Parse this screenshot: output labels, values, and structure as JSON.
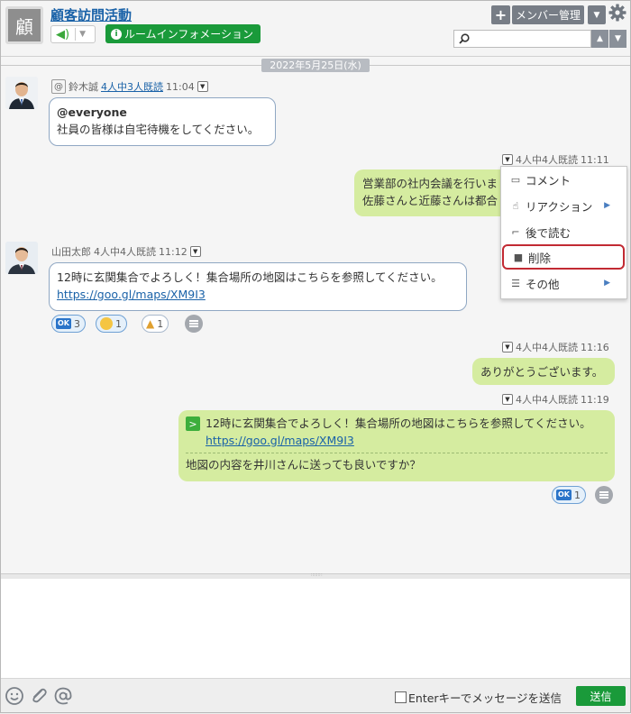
{
  "header": {
    "room_icon_char": "顧",
    "room_title": "顧客訪問活動",
    "room_info_label": "ルームインフォメーション",
    "member_button_label": "メンバー管理",
    "search_placeholder": ""
  },
  "date_separator": "2022年5月25日(水)",
  "messages": [
    {
      "sender": "鈴木誠",
      "read_status": "4人中3人既読",
      "time": "11:04",
      "lines": [
        "@everyone",
        "社員の皆様は自宅待機をしてください。"
      ]
    },
    {
      "self": true,
      "read_status": "4人中4人既読",
      "time": "11:11",
      "lines": [
        "営業部の社内会議を行いま",
        "佐藤さんと近藤さんは都合"
      ]
    },
    {
      "sender": "山田太郎",
      "read_status": "4人中4人既読",
      "time": "11:12",
      "lines": [
        "12時に玄関集合でよろしく！集合場所の地図はこちらを参照してください。"
      ],
      "link": "https://goo.gl/maps/XM9I3",
      "reactions": [
        {
          "icon": "ok-icon",
          "count": "3"
        },
        {
          "icon": "smile-icon",
          "count": "1"
        },
        {
          "icon": "thumbs-up-icon",
          "count": "1"
        }
      ]
    },
    {
      "self": true,
      "read_status": "4人中4人既読",
      "time": "11:16",
      "lines": [
        "ありがとうございます。"
      ]
    },
    {
      "self": true,
      "read_status": "4人中4人既読",
      "time": "11:19",
      "quote_text": "12時に玄関集合でよろしく！集合場所の地図はこちらを参照してください。",
      "quote_link": "https://goo.gl/maps/XM9I3",
      "reply_text": "地図の内容を井川さんに送っても良いですか？",
      "reactions": [
        {
          "icon": "ok-icon",
          "count": "1"
        }
      ]
    }
  ],
  "context_menu": {
    "items": [
      {
        "label": "コメント",
        "icon": "comment-icon"
      },
      {
        "label": "リアクション",
        "icon": "reaction-icon",
        "submenu": true
      },
      {
        "label": "後で読む",
        "icon": "bookmark-icon"
      },
      {
        "label": "削除",
        "icon": "trash-icon",
        "highlighted": true
      },
      {
        "label": "その他",
        "icon": "menu-icon",
        "submenu": true
      }
    ]
  },
  "composer": {
    "text": "",
    "enter_to_send_label": "Enterキーでメッセージを送信",
    "enter_to_send_checked": false,
    "send_label": "送信"
  },
  "colors": {
    "accent_green": "#1a9a3a",
    "link_blue": "#1a62a8",
    "own_bubble": "#d5eca0",
    "delete_highlight": "#c22a33"
  }
}
